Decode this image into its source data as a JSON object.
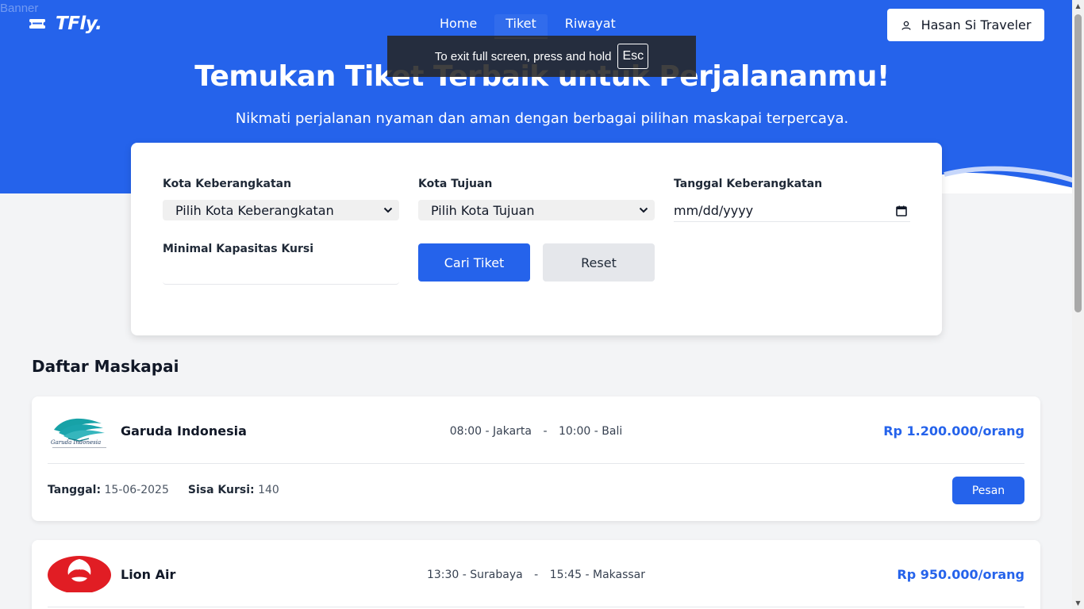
{
  "banner_alt": "Banner",
  "brand": {
    "name": "TFly."
  },
  "nav": [
    {
      "label": "Home"
    },
    {
      "label": "Tiket"
    },
    {
      "label": "Riwayat"
    }
  ],
  "user": {
    "name": "Hasan Si Traveler"
  },
  "hero": {
    "title": "Temukan Tiket Terbaik untuk Perjalananmu!",
    "subtitle": "Nikmati perjalanan nyaman dan aman dengan berbagai pilihan maskapai terpercaya."
  },
  "fullscreen_toast": {
    "text": "To exit full screen, press and hold",
    "key": "Esc"
  },
  "search": {
    "origin_label": "Kota Keberangkatan",
    "origin_value": "Pilih Kota Keberangkatan",
    "destination_label": "Kota Tujuan",
    "destination_value": "Pilih Kota Tujuan",
    "date_label": "Tanggal Keberangkatan",
    "date_value": "mm/dd/yyyy",
    "capacity_label": "Minimal Kapasitas Kursi",
    "capacity_value": "",
    "search_button": "Cari Tiket",
    "reset_button": "Reset"
  },
  "list_title": "Daftar Maskapai",
  "flights": [
    {
      "airline": "Garuda Indonesia",
      "depart": "08:00 - Jakarta",
      "separator": "-",
      "arrive": "10:00 - Bali",
      "price": "Rp 1.200.000/orang",
      "date_label": "Tanggal:",
      "date": "15-06-2025",
      "seats_label": "Sisa Kursi:",
      "seats": "140",
      "book_label": "Pesan",
      "logo_text": "Garuda Indonesia"
    },
    {
      "airline": "Lion Air",
      "depart": "13:30 - Surabaya",
      "separator": "-",
      "arrive": "15:45 - Makassar",
      "price": "Rp 950.000/orang"
    }
  ],
  "colors": {
    "primary": "#2563eb",
    "background": "#f3f4f6",
    "card": "#ffffff"
  },
  "icons": {
    "logo": "ticket-icon",
    "user": "user-icon",
    "dropdown": "chevron-down-icon",
    "calendar": "calendar-icon"
  }
}
